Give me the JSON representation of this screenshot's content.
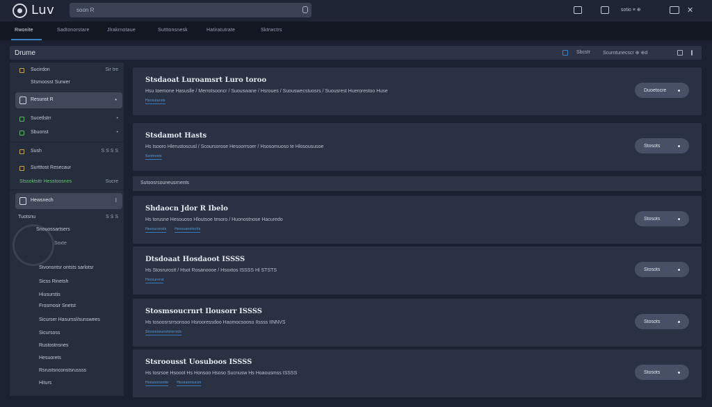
{
  "app": {
    "name": "Luv"
  },
  "search": {
    "value": "soon R",
    "icon": "search-icon"
  },
  "user": {
    "label": "sotio ≡ ⊕"
  },
  "close": {
    "label": "✕"
  },
  "tabs": [
    {
      "label": "Rwonite",
      "active": true
    },
    {
      "label": "Sadtonorstare"
    },
    {
      "label": "Jlrakrnotaue"
    },
    {
      "label": "Sutttonsnesk"
    },
    {
      "label": "Hatiratutrate"
    },
    {
      "label": "Sktrwctrs"
    }
  ],
  "page": {
    "title": "Drume",
    "right_label_1": "Sbcstr",
    "right_label_2": "Scurntunecscr ⊕ ⊕d"
  },
  "sidebar": {
    "items": [
      {
        "label": "Sucirdon",
        "right": "Sir tre"
      },
      {
        "label": "Stsmoosst Surwer"
      },
      {
        "label": "Resunst R",
        "right": "•",
        "selected": true
      },
      {
        "label": "Sucetlstrr",
        "right": "•"
      },
      {
        "label": "Sbuonst",
        "right": "•"
      },
      {
        "label": "Sush",
        "right": "S S S S"
      },
      {
        "label": "Surtttost Resecaur"
      },
      {
        "label": "Stssoktsttr Hesstoosnes",
        "right": "Sucre"
      },
      {
        "label": "Hewsnech",
        "right": "I",
        "selected": true
      },
      {
        "label": "Tuotsnu",
        "right": "S S S"
      }
    ],
    "group_label": "Snouossartsers",
    "group_badge": "Soxte",
    "sub_items": [
      "Stvonsntsr ontsts sarlotsr",
      "Sicss Rinetsh",
      "Hiusurstis",
      "Frosmosir Snetst",
      "Sicurser Hasurssl/sunswees",
      "Sicursoss",
      "Rustostnsnes",
      "Hesuorets",
      "Rsrustsnconstsrussss",
      "Hiturs"
    ]
  },
  "section": {
    "label": "Sutoosrsouneusrnents"
  },
  "cards": [
    {
      "title": "Stsdaoat Luroamsrt Luro toroo",
      "desc": "Hsu toemone Hasuslle / Merrotsooncr / Suouswane / Hsroues / Suouswecstuosrs / Suousrest Huerorestoo Huse",
      "tags": [
        "Hsosutarots"
      ],
      "button": "Duoetocre"
    },
    {
      "title": "Stsdamot Hasts",
      "desc": "Hs tsooro Hlerustoscusl / Scoursorose Hesoorrsoer / Hsosomuoso te Hlosoususoe",
      "tags": [
        "Ssotnosts"
      ],
      "button": "Stosots"
    },
    {
      "title": "Shdaocn Jdor R Ibelo",
      "desc": "Hs torusne Hesouoso Hloutsoe tesoro / Huonostnose Hacuredo",
      "tags": [
        "Hesouronsts",
        "Hesousnotsctts"
      ],
      "button": "Stosots"
    },
    {
      "title": "Dtsdoaat Hosdaoot ISSSS",
      "desc": "Hs Stosrurostt / Hsot Rosanoooe / Hsoxtos ISSSS Hl STSTS",
      "tags": [
        "Hsosurorot"
      ],
      "button": "Stosots"
    },
    {
      "title": "Stosmsoucrnrt Ilousorr ISSSS",
      "desc": "Hs tosoosrsrrsonsoo Hsrooressdoo Haomocsooso IIssss IINNVS",
      "tags": [
        "Stosnsoeuostsrerosts"
      ],
      "button": "Stosots"
    },
    {
      "title": "Stsroousst Uosuboos ISSSS",
      "desc": "Hs tosrsoe Hsooot Hs Honsoo Hsoso Sucnusw Hs Hoaousmss ISSSS",
      "tags": [
        "Hosusorsonte",
        "Hsosuonsucsn"
      ],
      "button": "Stosots"
    }
  ],
  "colors": {
    "accent": "#3b82c4",
    "tag": "#5aa0e0",
    "green": "#6cc27a",
    "gold": "#c7a25a"
  }
}
